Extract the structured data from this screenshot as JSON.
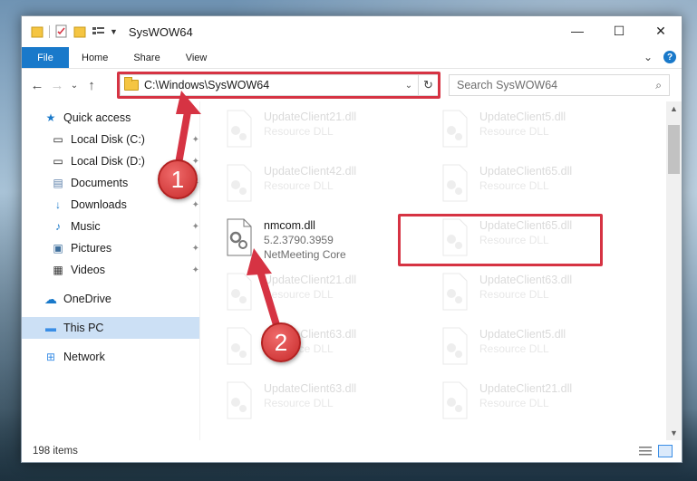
{
  "window": {
    "title": "SysWOW64",
    "controls": {
      "minimize": "—",
      "maximize": "☐",
      "close": "✕"
    }
  },
  "ribbon": {
    "tabs": [
      "File",
      "Home",
      "Share",
      "View"
    ],
    "expand": "⌄",
    "help": "?"
  },
  "address": {
    "path": "C:\\Windows\\SysWOW64",
    "chevron": "⌄",
    "refresh": "↻"
  },
  "nav": {
    "back": "←",
    "forward": "→",
    "recent": "⌄",
    "up": "↑"
  },
  "search": {
    "placeholder": "Search SysWOW64",
    "icon": "⌕"
  },
  "sidebar": {
    "items": [
      {
        "label": "Quick access",
        "icon": "★"
      },
      {
        "label": "Local Disk (C:)",
        "icon": "▭"
      },
      {
        "label": "Local Disk (D:)",
        "icon": "▭"
      },
      {
        "label": "Documents",
        "icon": "▤"
      },
      {
        "label": "Downloads",
        "icon": "↓"
      },
      {
        "label": "Music",
        "icon": "♪"
      },
      {
        "label": "Pictures",
        "icon": "▣"
      },
      {
        "label": "Videos",
        "icon": "▦"
      },
      {
        "label": "OneDrive",
        "icon": "☁"
      },
      {
        "label": "This PC",
        "icon": "▬"
      },
      {
        "label": "Network",
        "icon": "⊞"
      }
    ],
    "pin": "📌"
  },
  "files": {
    "highlighted": {
      "name": "nmcom.dll",
      "version": "5.2.3790.3959",
      "desc": "NetMeeting Core"
    },
    "left": [
      {
        "name": "UpdateClient21.dll",
        "desc": "Resource DLL"
      },
      {
        "name": "UpdateClient42.dll",
        "desc": "Resource DLL"
      },
      {
        "name": "UpdateClient21.dll",
        "desc": "Resource DLL"
      },
      {
        "name": "UpdateClient63.dll",
        "desc": "Resource DLL"
      },
      {
        "name": "UpdateClient63.dll",
        "desc": "Resource DLL"
      }
    ],
    "right": [
      {
        "name": "UpdateClient5.dll",
        "desc": "Resource DLL"
      },
      {
        "name": "UpdateClient65.dll",
        "desc": "Resource DLL"
      },
      {
        "name": "UpdateClient65.dll",
        "desc": "Resource DLL"
      },
      {
        "name": "UpdateClient63.dll",
        "desc": "Resource DLL"
      },
      {
        "name": "UpdateClient5.dll",
        "desc": "Resource DLL"
      },
      {
        "name": "UpdateClient21.dll",
        "desc": "Resource DLL"
      }
    ]
  },
  "status": {
    "count": "198 items"
  },
  "annotations": {
    "marker1": "1",
    "marker2": "2",
    "color": "#d63343"
  }
}
